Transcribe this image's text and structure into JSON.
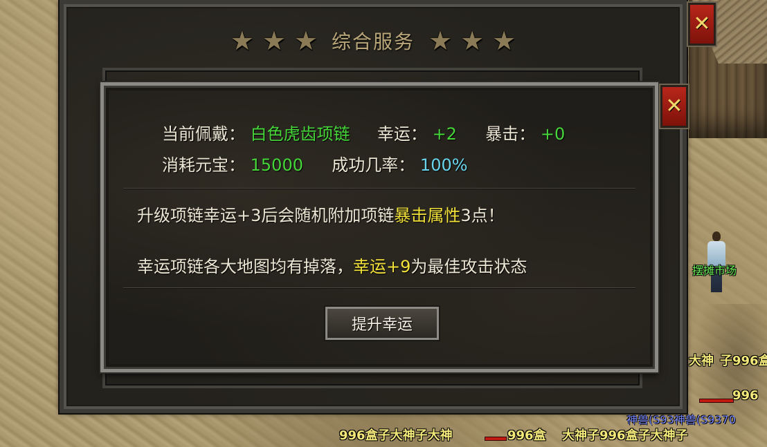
{
  "window": {
    "title": "综合服务",
    "close_label": "✕"
  },
  "dialog": {
    "close_label": "✕",
    "current_label": "当前佩戴：",
    "current_item": "白色虎齿项链",
    "luck_label": "幸运：",
    "luck_value": "+2",
    "crit_label": "暴击：",
    "crit_value": "+0",
    "cost_label": "消耗元宝：",
    "cost_value": "15000",
    "rate_label": "成功几率：",
    "rate_value": "100%",
    "desc1_a": "升级项链幸运+3后会随机附加项链",
    "desc1_highlight": "暴击属性",
    "desc1_b": "3点！",
    "desc2_a": "幸运项链各大地图均有掉落，",
    "desc2_highlight": "幸运+9",
    "desc2_b": "为最佳攻击状态",
    "button_label": "提升幸运"
  },
  "scene": {
    "npc_label": "摆摊市场",
    "name_1": "大神",
    "name_2": "子996盒",
    "name_3": "996",
    "guild_text": "神兽(S93神兽(S9370",
    "bottom_names": "996盒子大神子大神",
    "bottom_names_2": "996盒",
    "bottom_names_3": "大神子996盒子大神子",
    "bottom_names_4": "大神"
  },
  "colors": {
    "accent_green": "#46d63a",
    "accent_cyan": "#6ad5ee",
    "accent_yellow": "#f2e23a",
    "close_red": "#b8261a"
  }
}
